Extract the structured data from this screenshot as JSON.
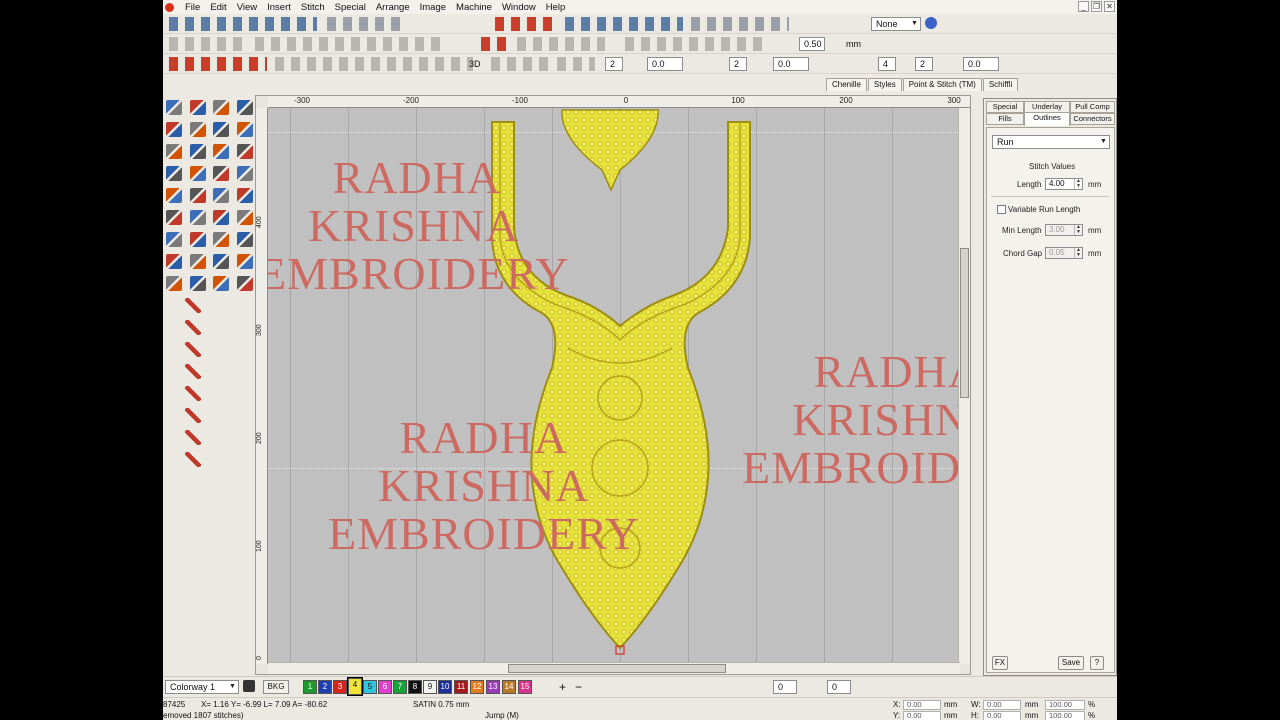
{
  "menu": [
    "File",
    "Edit",
    "View",
    "Insert",
    "Stitch",
    "Special",
    "Arrange",
    "Image",
    "Machine",
    "Window",
    "Help"
  ],
  "window_controls": [
    "_",
    "❐",
    "✕"
  ],
  "toolbar": {
    "none_combo": "None",
    "zoom_value": "0.50",
    "zoom_unit": "mm",
    "spin_a": "2",
    "spin_a_val": "0.0",
    "spin_b": "2",
    "spin_b_val": "0.0",
    "spin_c": "4",
    "spin_d": "2",
    "spin_d_val": "0.0",
    "threeD": "3D"
  },
  "top_tabs": [
    "Chenille",
    "Styles",
    "Point & Stitch (TM)",
    "Schiffli"
  ],
  "ruler": {
    "top": [
      "-300",
      "-200",
      "-100",
      "0",
      "100",
      "200",
      "300"
    ],
    "left": [
      "400",
      "300",
      "200",
      "100",
      "0"
    ]
  },
  "watermarks": [
    [
      "RADHA",
      "KRISHNA",
      "EMBROIDERY"
    ],
    [
      "RADHA",
      "KRISHNA",
      "EMBROIDERY"
    ],
    [
      "RADHA",
      "KRISHNA",
      "EMBROIDERY"
    ]
  ],
  "right_panel": {
    "tabs_row1": [
      "Special",
      "Underlay",
      "Pull Comp"
    ],
    "tabs_row2": [
      "Fills",
      "Outlines",
      "Connectors"
    ],
    "active_tab": "Outlines",
    "stitch_type": "Run",
    "stitch_values_title": "Stitch Values",
    "length_label": "Length",
    "length_value": "4.00",
    "unit": "mm",
    "variable_run_label": "Variable Run Length",
    "min_length_label": "Min Length",
    "min_length_value": "3.00",
    "chord_gap_label": "Chord Gap",
    "chord_gap_value": "0.05",
    "fx_button": "FX",
    "save_button": "Save",
    "help_button": "?"
  },
  "colorbar": {
    "colorway": "Colorway 1",
    "bkg": "BKG",
    "swatches": [
      {
        "n": "1",
        "color": "#1f9a2c"
      },
      {
        "n": "2",
        "color": "#1f3fb0"
      },
      {
        "n": "3",
        "color": "#d8241d"
      },
      {
        "n": "4",
        "color": "#f2e33a"
      },
      {
        "n": "5",
        "color": "#2fc4e0"
      },
      {
        "n": "6",
        "color": "#e03fd0"
      },
      {
        "n": "7",
        "color": "#18a33a"
      },
      {
        "n": "8",
        "color": "#111111"
      },
      {
        "n": "9",
        "color": "#f4f4f4"
      },
      {
        "n": "10",
        "color": "#1c2f9a"
      },
      {
        "n": "11",
        "color": "#a3191e"
      },
      {
        "n": "12",
        "color": "#e47a1e"
      },
      {
        "n": "13",
        "color": "#9c3ab7"
      },
      {
        "n": "14",
        "color": "#b87a2a"
      },
      {
        "n": "15",
        "color": "#d6368a"
      }
    ],
    "selected": "4",
    "plus": "+",
    "minus": "−",
    "spin1": "0",
    "spin2": "0"
  },
  "status": {
    "line1_count": "87425",
    "line1_coords": "X=  1.16 Y= -6.99 L=  7.09 A= -80.62",
    "line1_stitch": "SATIN  0.75 mm",
    "line2_msg": "emoved 1807 stitches)",
    "line2_jump": "Jump (M)",
    "x_label": "X:",
    "x_value": "0.00",
    "y_label": "Y:",
    "y_value": "0.00",
    "w_label": "W:",
    "w_value": "0.00",
    "h_label": "H:",
    "h_value": "0.00",
    "unit": "mm",
    "pct1": "100.00",
    "pct2": "100.00",
    "pct_sign": "%"
  },
  "colors": {
    "embroidery_fill": "#e6e33a",
    "embroidery_outline": "#b7a41a",
    "watermark": "#cc6a62",
    "canvas_bg": "#c0c0c0"
  }
}
